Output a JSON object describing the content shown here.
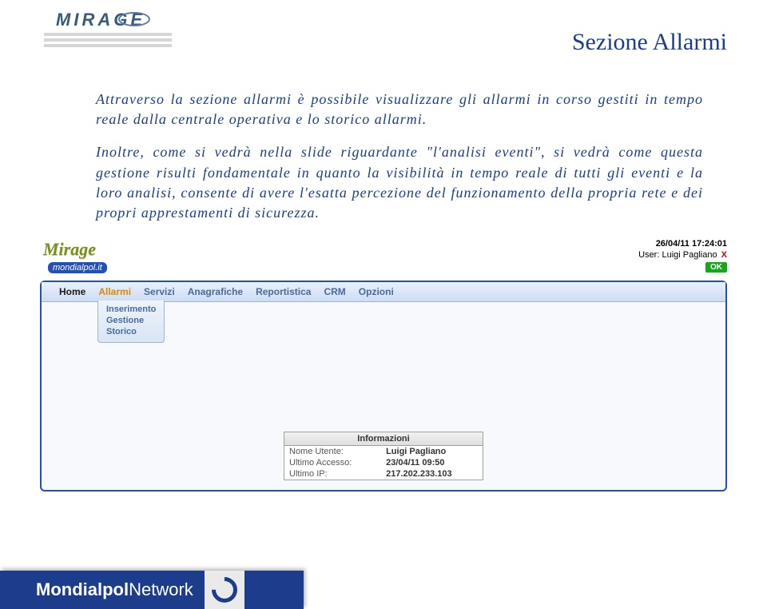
{
  "header": {
    "logo_text": "MIRAGE",
    "section_title": "Sezione Allarmi"
  },
  "body": {
    "p1": "Attraverso la sezione allarmi è possibile visualizzare gli allarmi in corso gestiti in tempo reale dalla centrale operativa e lo storico allarmi.",
    "p2": "Inoltre, come si vedrà nella slide riguardante \"l'analisi eventi\", si vedrà come questa gestione risulti fondamentale in quanto la visibilità in tempo reale di tutti gli eventi e la loro analisi, consente di avere l'esatta percezione del funzionamento della propria rete e dei propri apprestamenti di sicurezza."
  },
  "app": {
    "brand1": "Mirage",
    "brand2": "mondialpol.it",
    "datetime": "26/04/11 17:24:01",
    "user_label": "User:",
    "user_name": "Luigi Pagliano",
    "ok": "OK",
    "menu": {
      "home": "Home",
      "allarmi": "Allarmi",
      "servizi": "Servizi",
      "anagrafiche": "Anagrafiche",
      "reportistica": "Reportistica",
      "crm": "CRM",
      "opzioni": "Opzioni"
    },
    "submenu": {
      "inserimento": "Inserimento",
      "gestione": "Gestione",
      "storico": "Storico"
    },
    "info": {
      "title": "Informazioni",
      "k1": "Nome Utente:",
      "v1": "Luigi Pagliano",
      "k2": "Ultimo Accesso:",
      "v2": "23/04/11 09:50",
      "k3": "Ultimo IP:",
      "v3": "217.202.233.103"
    }
  },
  "footer": {
    "brand1": "Mondialpol",
    "brand2": "Network"
  }
}
